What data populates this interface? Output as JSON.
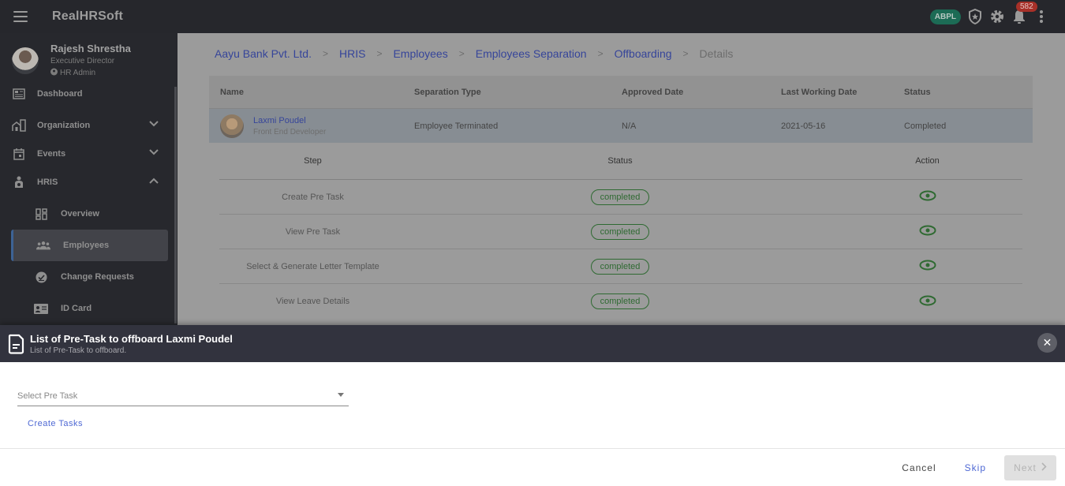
{
  "app": {
    "title": "RealHRSoft"
  },
  "topbar": {
    "org_badge": "ABPL",
    "notification_count": "582"
  },
  "profile": {
    "name": "Rajesh Shrestha",
    "role": "Executive Director",
    "permission": "HR Admin"
  },
  "sidebar": {
    "items": [
      {
        "label": "Dashboard",
        "icon": "dashboard-icon"
      },
      {
        "label": "Organization",
        "icon": "organization-icon",
        "expanded": false
      },
      {
        "label": "Events",
        "icon": "calendar-icon",
        "expanded": false
      },
      {
        "label": "HRIS",
        "icon": "person-icon",
        "expanded": true
      }
    ],
    "sub_items": [
      {
        "label": "Overview",
        "icon": "overview-icon"
      },
      {
        "label": "Employees",
        "icon": "group-icon",
        "active": true
      },
      {
        "label": "Change Requests",
        "icon": "check-circle-icon"
      },
      {
        "label": "ID Card",
        "icon": "id-card-icon"
      }
    ]
  },
  "breadcrumb": {
    "links": [
      "Aayu Bank Pvt. Ltd.",
      "HRIS",
      "Employees",
      "Employees Separation",
      "Offboarding"
    ],
    "current": "Details"
  },
  "employee_table": {
    "headers": [
      "Name",
      "Separation Type",
      "Approved Date",
      "Last Working Date",
      "Status"
    ],
    "row": {
      "name": "Laxmi Poudel",
      "designation": "Front End Developer",
      "separation_type": "Employee Terminated",
      "approved_date": "N/A",
      "last_working_date": "2021-05-16",
      "status": "Completed"
    }
  },
  "steps_table": {
    "headers": [
      "Step",
      "Status",
      "Action"
    ],
    "rows": [
      {
        "step": "Create Pre Task",
        "status": "completed"
      },
      {
        "step": "View Pre Task",
        "status": "completed"
      },
      {
        "step": "Select & Generate Letter Template",
        "status": "completed"
      },
      {
        "step": "View Leave Details",
        "status": "completed"
      }
    ]
  },
  "drawer": {
    "title": "List of Pre-Task to offboard Laxmi Poudel",
    "subtitle": "List of Pre-Task to offboard.",
    "select_placeholder": "Select Pre Task",
    "create_link": "Create Tasks",
    "cancel_label": "Cancel",
    "skip_label": "Skip",
    "next_label": "Next"
  },
  "colors": {
    "topbar": "#26272c",
    "sidebar": "#27282d",
    "accent_link": "#4f69d4",
    "success": "#2f6a32",
    "badge_red": "#a73028",
    "org_badge": "#1c6b55"
  }
}
